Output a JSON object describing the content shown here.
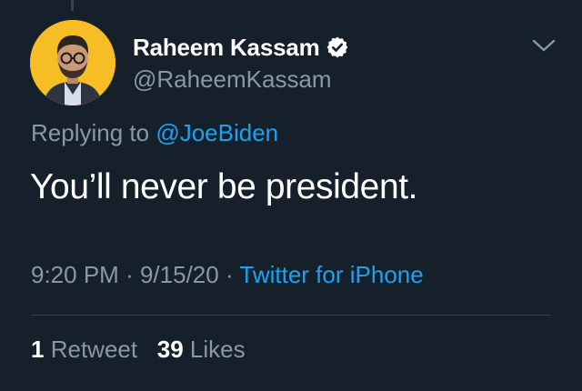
{
  "colors": {
    "background": "#15202b",
    "primary_text": "#ffffff",
    "secondary_text": "#8899a6",
    "link": "#1da1f2",
    "divider": "#38444d",
    "avatar_bg": "#f6bd24"
  },
  "tweet": {
    "author": {
      "display_name": "Raheem Kassam",
      "handle": "@RaheemKassam",
      "verified_icon": "verified-badge-icon",
      "avatar": "profile-photo"
    },
    "reply": {
      "prefix": "Replying to",
      "mention": "@JoeBiden"
    },
    "text": "You’ll never be president.",
    "meta": {
      "time": "9:20 PM",
      "sep1": "·",
      "date": "9/15/20",
      "sep2": "·",
      "source": "Twitter for iPhone"
    },
    "stats": {
      "retweets_count": "1",
      "retweets_label": "Retweet",
      "likes_count": "39",
      "likes_label": "Likes"
    },
    "menu_icon": "chevron-down-icon"
  }
}
